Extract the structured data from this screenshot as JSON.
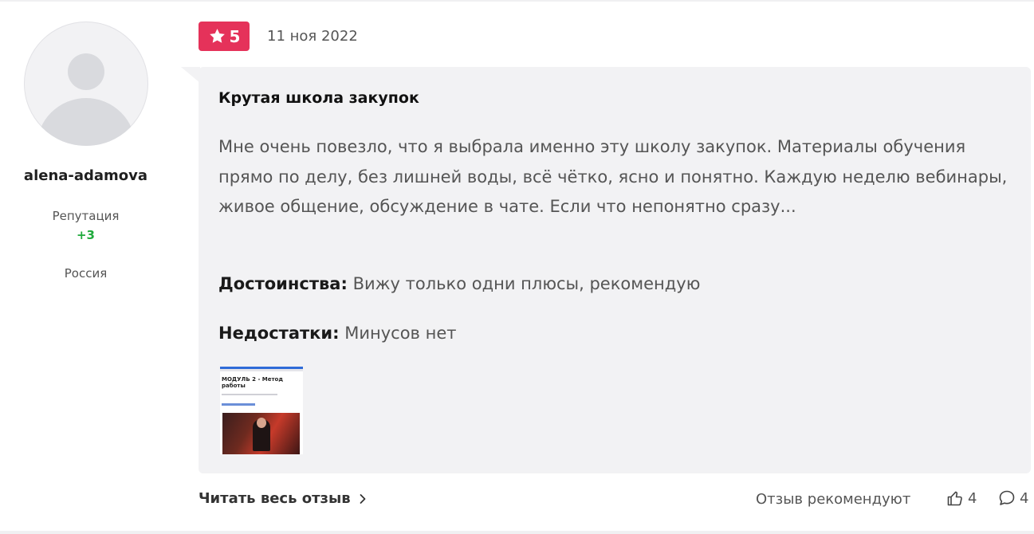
{
  "author": {
    "username": "alena-adamova",
    "reputation_label": "Репутация",
    "reputation_value": "+3",
    "country": "Россия"
  },
  "review": {
    "rating": "5",
    "date": "11 ноя 2022",
    "title": "Крутая школа закупок",
    "text": "Мне очень повезло, что я выбрала именно эту школу закупок. Материалы обучения прямо по делу, без лишней воды, всё чётко, ясно и понятно. Каждую неделю вебинары, живое общение, обсуждение в чате. Если что непонятно сразу...",
    "pros_label": "Достоинства:",
    "pros": "Вижу только одни плюсы, рекомендую",
    "cons_label": "Недостатки:",
    "cons": "Минусов нет",
    "attachment_title": "МОДУЛЬ 2 - Метод работы"
  },
  "footer": {
    "read_more": "Читать весь отзыв",
    "recommend_label": "Отзыв рекомендуют",
    "likes": "4",
    "comments": "4"
  },
  "colors": {
    "badge": "#e5325a",
    "reputation": "#1faa3c",
    "bubble": "#f2f2f4"
  },
  "icons": [
    "star-icon",
    "chevron-right-icon",
    "thumbs-up-icon",
    "comment-icon"
  ]
}
